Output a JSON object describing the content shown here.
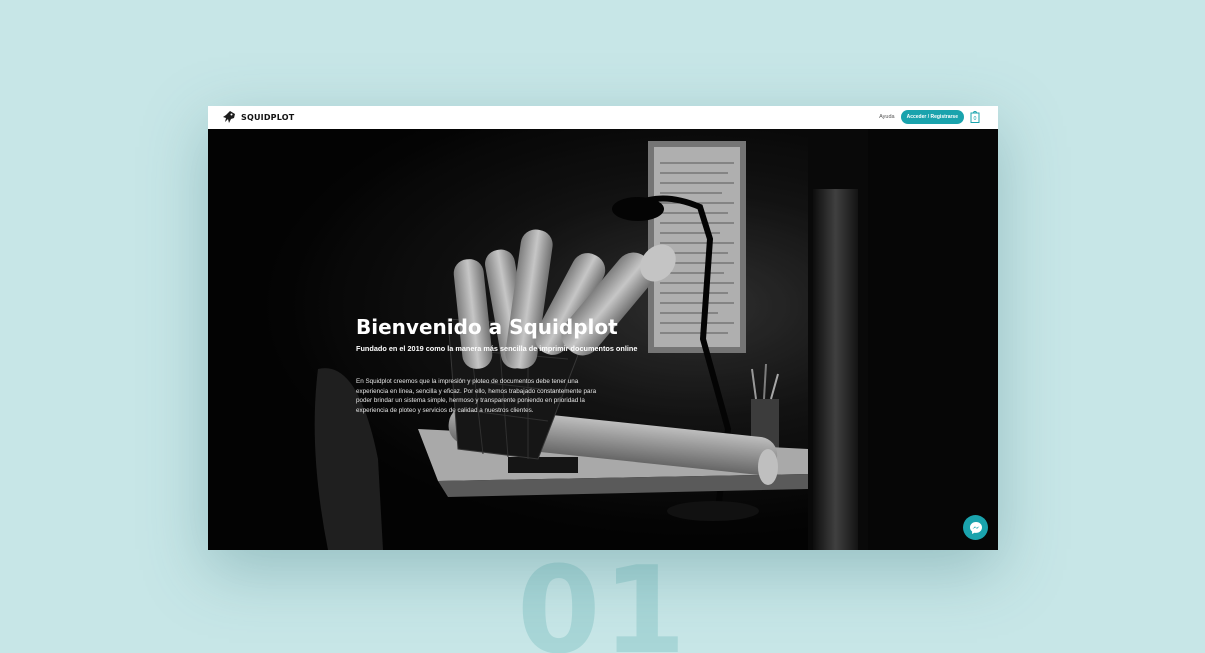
{
  "brand": {
    "name": "SQUIDPLOT",
    "logo_icon": "squid-logo-icon"
  },
  "nav": {
    "help_label": "Ayuda",
    "login_label": "Acceder / Registrarse",
    "cart_icon": "cart-icon"
  },
  "hero": {
    "title": "Bienvenido a Squidplot",
    "subtitle": "Fundado en el 2019 como la manera más sencilla de imprimir documentos online",
    "body": "En Squidplot creemos que la impresión y ploteo de documentos debe tener una experiencia en línea, sencilla y eficaz. Por ello, hemos trabajado constantemente para poder brindar un sistema simple, hermoso y transparente poniendo en prioridad la experiencia de ploteo y servicios de calidad a nuestros clientes."
  },
  "chat": {
    "icon": "messenger-icon"
  },
  "showcase": {
    "number": "01"
  },
  "colors": {
    "accent": "#1aa3ad",
    "background": "#c7e6e7",
    "number": "#a8d6d7"
  }
}
